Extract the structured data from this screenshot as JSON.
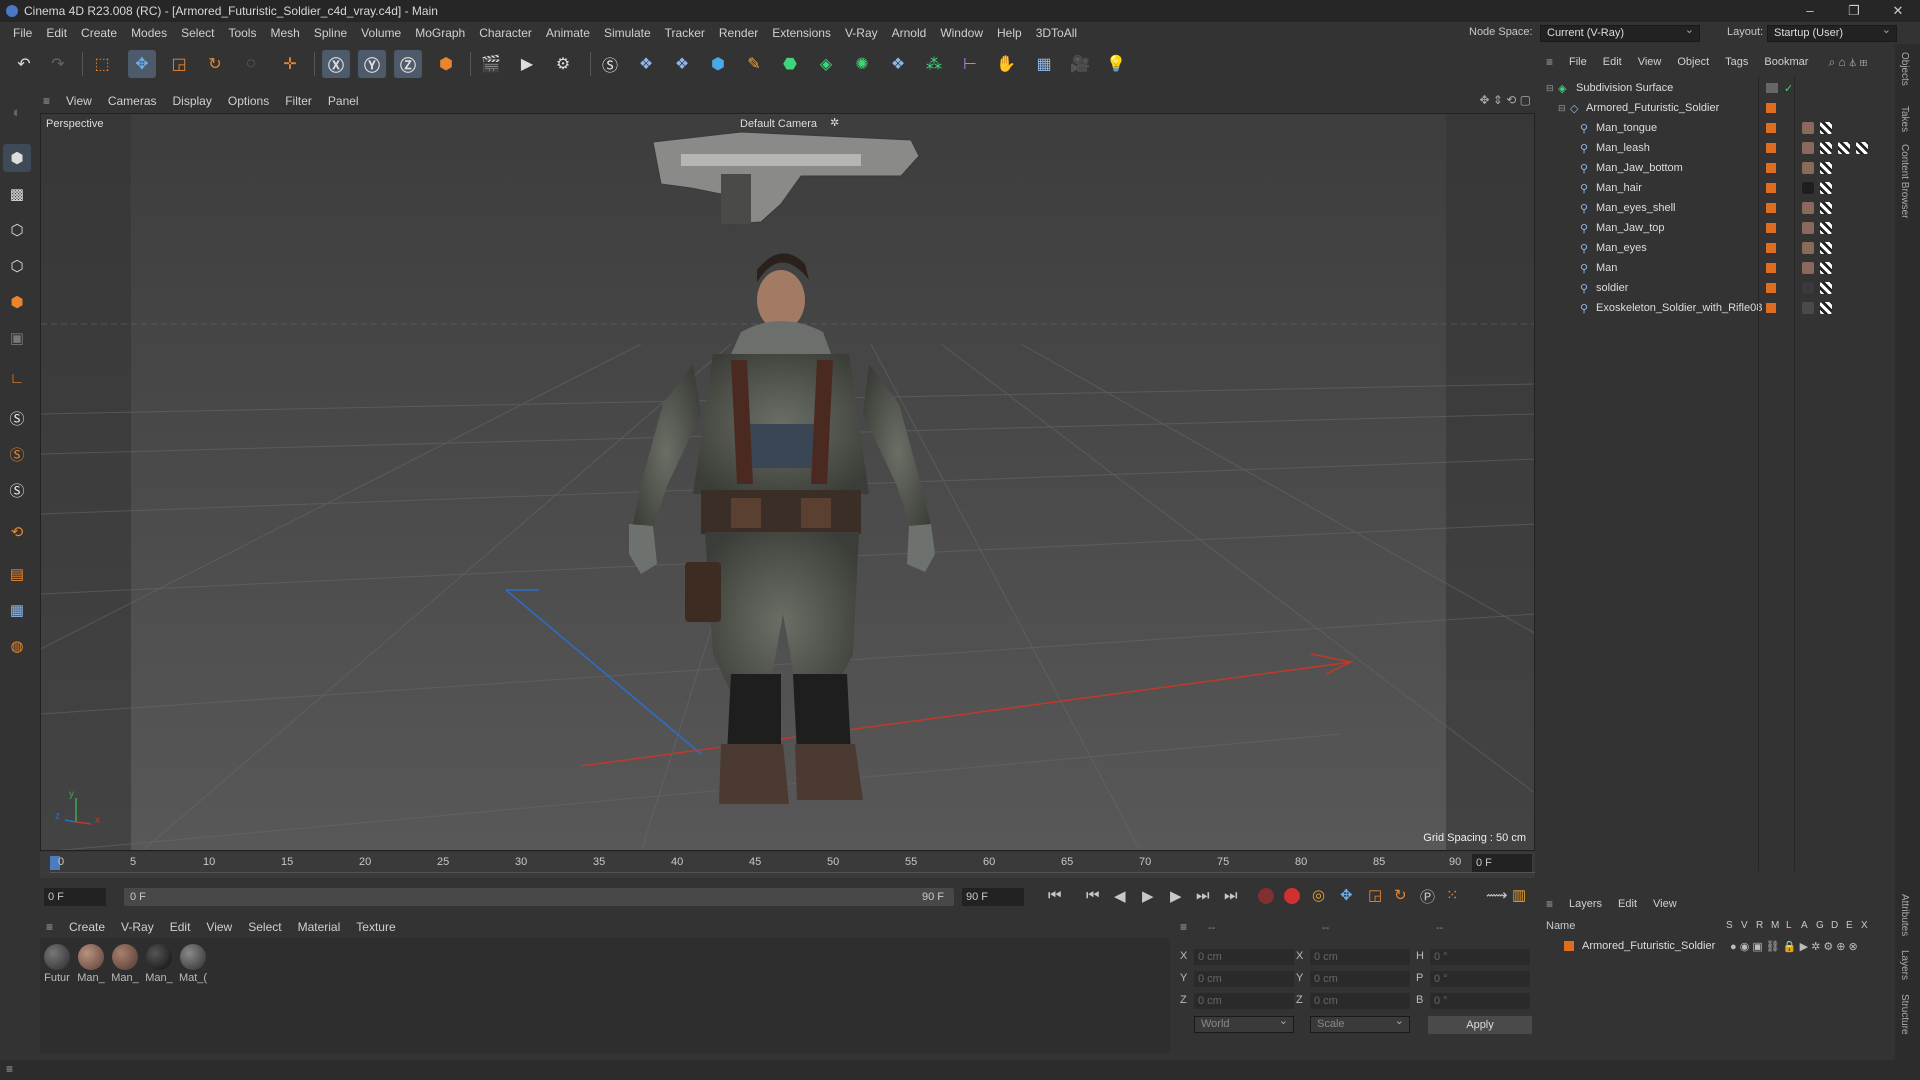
{
  "window": {
    "title": "Cinema 4D R23.008 (RC) - [Armored_Futuristic_Soldier_c4d_vray.c4d] - Main",
    "controls": [
      "–",
      "❐",
      "✕"
    ]
  },
  "menubar": {
    "items": [
      "File",
      "Edit",
      "Create",
      "Modes",
      "Select",
      "Tools",
      "Mesh",
      "Spline",
      "Volume",
      "MoGraph",
      "Character",
      "Animate",
      "Simulate",
      "Tracker",
      "Render",
      "Extensions",
      "V-Ray",
      "Arnold",
      "Window",
      "Help",
      "3DToAll"
    ],
    "node_space_label": "Node Space:",
    "node_space_value": "Current (V-Ray)",
    "layout_label": "Layout:",
    "layout_value": "Startup (User)"
  },
  "viewport": {
    "menu": [
      "View",
      "Cameras",
      "Display",
      "Options",
      "Filter",
      "Panel"
    ],
    "view_name": "Perspective",
    "camera_label": "Default Camera",
    "camera_icon": "camera-icon",
    "grid_spacing": "Grid Spacing : 50 cm",
    "axis_labels": {
      "x": "x",
      "y": "y",
      "z": "z"
    }
  },
  "timeline": {
    "ticks": [
      "0",
      "5",
      "10",
      "15",
      "20",
      "25",
      "30",
      "35",
      "40",
      "45",
      "50",
      "55",
      "60",
      "65",
      "70",
      "75",
      "80",
      "85",
      "90"
    ],
    "current_frame": "0 F",
    "start_frame": "0 F",
    "range_start": "0 F",
    "range_end": "90 F",
    "end_frame": "90 F"
  },
  "materials": {
    "menu": [
      "Create",
      "V-Ray",
      "Edit",
      "View",
      "Select",
      "Material",
      "Texture"
    ],
    "items": [
      {
        "label": "Futur",
        "color": "#3a3a3a"
      },
      {
        "label": "Man_",
        "color": "#8a6a5a"
      },
      {
        "label": "Man_",
        "color": "#7d5e4f"
      },
      {
        "label": "Man_",
        "color": "#1e1e1e"
      },
      {
        "label": "Mat_(",
        "color": "#4a4a4a"
      }
    ]
  },
  "coordinates": {
    "header": [
      "--",
      "--",
      "--"
    ],
    "rows": [
      {
        "a": "X",
        "av": "0 cm",
        "b": "X",
        "bv": "0 cm",
        "c": "H",
        "cv": "0 °"
      },
      {
        "a": "Y",
        "av": "0 cm",
        "b": "Y",
        "bv": "0 cm",
        "c": "P",
        "cv": "0 °"
      },
      {
        "a": "Z",
        "av": "0 cm",
        "b": "Z",
        "bv": "0 cm",
        "c": "B",
        "cv": "0 °"
      }
    ],
    "space_value": "World",
    "mode_value": "Scale",
    "apply_label": "Apply"
  },
  "objects": {
    "menu": [
      "File",
      "Edit",
      "View",
      "Object",
      "Tags",
      "Bookmar"
    ],
    "root": "Subdivision Surface",
    "group": "Armored_Futuristic_Soldier",
    "children": [
      "Man_tongue",
      "Man_leash",
      "Man_Jaw_bottom",
      "Man_hair",
      "Man_eyes_shell",
      "Man_Jaw_top",
      "Man_eyes",
      "Man",
      "soldier",
      "Exoskeleton_Soldier_with_Rifle08"
    ]
  },
  "layers": {
    "menu": [
      "Layers",
      "Edit",
      "View"
    ],
    "header_name": "Name",
    "header_flags": [
      "S",
      "V",
      "R",
      "M",
      "L",
      "A",
      "G",
      "D",
      "E",
      "X"
    ],
    "items": [
      "Armored_Futuristic_Soldier"
    ]
  },
  "side_tabs": [
    "Objects",
    "Takes",
    "Content Browser",
    "Attributes",
    "Layers",
    "Structure"
  ],
  "colors": {
    "accent": "#e06c1f",
    "selection": "#4c5a6a",
    "x_axis": "#c0392b",
    "y_axis": "#3ea55a",
    "z_axis": "#2a6fc9"
  }
}
